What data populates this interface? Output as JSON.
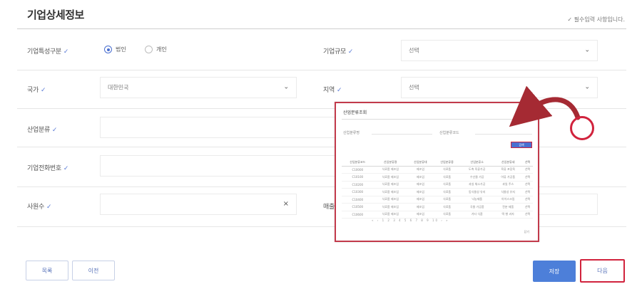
{
  "page": {
    "title": "기업상세정보",
    "required_note": "✓ 필수입력 사항입니다.",
    "check_mark": "✓"
  },
  "form": {
    "company_type": {
      "label": "기업특성구분",
      "options": [
        "법인",
        "개인"
      ],
      "selected": "법인"
    },
    "company_size": {
      "label": "기업규모",
      "value": "선택"
    },
    "country": {
      "label": "국가",
      "value": "대한민국"
    },
    "region": {
      "label": "지역",
      "value": "선택"
    },
    "industry": {
      "label": "산업분류",
      "value": ""
    },
    "phone": {
      "label": "기업전화번호",
      "value": ""
    },
    "employees": {
      "label": "사원수",
      "value": "",
      "clear_icon": "×"
    },
    "sales": {
      "label": "매출",
      "value": ""
    }
  },
  "buttons": {
    "list": "목록",
    "prev": "이전",
    "save": "저장",
    "next": "다음"
  },
  "modal": {
    "title": "산업분류조회",
    "label_1": "산업분류명",
    "label_2": "산업분류코드",
    "search": "검색",
    "columns": [
      "산업분류코드",
      "산업분류명",
      "산업분류대",
      "산업분류중",
      "산업분류소",
      "산업분류세",
      "선택"
    ],
    "rows": [
      [
        "C10000",
        "식료품 제조업",
        "제조업",
        "식료품",
        "도축 육류가공",
        "육류 포장육",
        "선택"
      ],
      [
        "C10100",
        "식료품 제조업",
        "제조업",
        "식료품",
        "수산물 가공",
        "어류 가공품",
        "선택"
      ],
      [
        "C10200",
        "식료품 제조업",
        "제조업",
        "식료품",
        "과실 채소가공",
        "과일 주스",
        "선택"
      ],
      [
        "C10300",
        "식료품 제조업",
        "제조업",
        "식료품",
        "동식물성 유지",
        "식물성 유지",
        "선택"
      ],
      [
        "C10400",
        "식료품 제조업",
        "제조업",
        "식료품",
        "낙농제품",
        "아이스크림",
        "선택"
      ],
      [
        "C10500",
        "식료품 제조업",
        "제조업",
        "식료품",
        "곡물 가공품",
        "전분 제품",
        "선택"
      ],
      [
        "C10600",
        "식료품 제조업",
        "제조업",
        "식료품",
        "기타 식품",
        "떡 빵 과자",
        "선택"
      ]
    ],
    "pager": "« ‹ 1 2 3 4 5 6 7 8 9 10 › »",
    "close": "닫기"
  },
  "colors": {
    "accent": "#4d7fd9",
    "annotation": "#d1233d",
    "arrow": "#a52a33"
  }
}
